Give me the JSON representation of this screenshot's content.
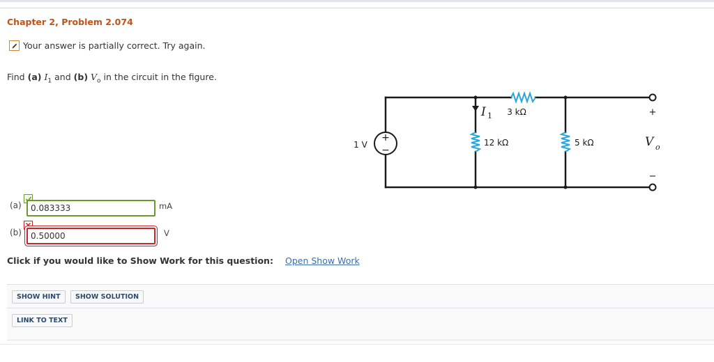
{
  "header": {
    "chapter_title": "Chapter 2, Problem 2.074"
  },
  "status": {
    "icon": "pencil-icon",
    "text": "Your answer is partially correct.  Try again."
  },
  "question": {
    "find": "Find",
    "part_a": "(a)",
    "var_a": "I",
    "var_a_sub": "1",
    "and": "and",
    "part_b": "(b)",
    "var_b": "V",
    "var_b_sub": "o",
    "rest": "in the circuit in the figure."
  },
  "circuit": {
    "source_label": "1 V",
    "source_plus": "+",
    "source_minus": "−",
    "current_label": "I",
    "current_sub": "1",
    "r_series": "3 kΩ",
    "r_left": "12 kΩ",
    "r_right": "5 kΩ",
    "vo_plus": "+",
    "vo_label": "V",
    "vo_sub": "o",
    "vo_minus": "−"
  },
  "answers": {
    "a": {
      "label": "(a)",
      "value": "0.083333",
      "unit": "mA",
      "status": "correct"
    },
    "b": {
      "label": "(b)",
      "value": "0.50000",
      "unit": "V",
      "status": "incorrect"
    }
  },
  "show_work": {
    "prompt": "Click if you would like to Show Work for this question:",
    "link": "Open Show Work"
  },
  "buttons": {
    "hint": "SHOW HINT",
    "solution": "SHOW SOLUTION",
    "link_to_text": "LINK TO TEXT"
  },
  "colors": {
    "chapter": "#c0541a",
    "status_border": "#d9822b",
    "resistor": "#29a7dc",
    "correct": "#6b9a2c",
    "incorrect": "#c8262a",
    "link": "#3d6ea4"
  }
}
